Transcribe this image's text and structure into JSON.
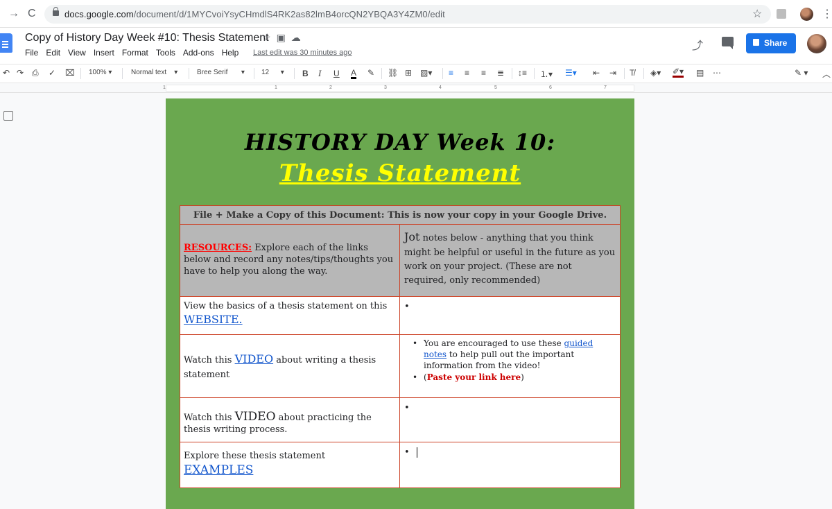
{
  "browser": {
    "url_main": "docs.google.com",
    "url_rest": "/document/d/1MYCvoiYsyCHmdlS4RK2as82lmB4orcQN2YBQA3Y4ZM0/edit"
  },
  "docs": {
    "title": "Copy of History Day Week #10: Thesis Statement",
    "menu": [
      "File",
      "Edit",
      "View",
      "Insert",
      "Format",
      "Tools",
      "Add-ons",
      "Help"
    ],
    "last_edit": "Last edit was 30 minutes ago",
    "share_label": "Share"
  },
  "toolbar": {
    "zoom": "100%",
    "style": "Normal text",
    "font": "Bree Serif",
    "size": "12",
    "bold": "B",
    "italic": "I",
    "underline": "U",
    "textcolor": "A"
  },
  "ruler": {
    "numbers": [
      "1",
      "1",
      "2",
      "3",
      "4",
      "5",
      "6",
      "7"
    ]
  },
  "document": {
    "heading1": "HISTORY DAY Week 10:",
    "heading2": "Thesis Statement",
    "table": {
      "header": "File + Make a Copy of this Document: This is now your copy in your Google Drive.",
      "resources_label": "RESOURCES:",
      "resources_text": " Explore each of the links below and record any notes/tips/thoughts you have to help you along the way.",
      "jot_big": "Jot",
      "jot_text": " notes below - anything that you think might be helpful or useful in the future as you work on your project. (These are not required, only recommended)",
      "row1_text": "View the basics of a thesis statement on this ",
      "row1_link": "WEBSITE.",
      "row2_pre": "Watch this ",
      "row2_link": "VIDEO",
      "row2_post": " about writing a thesis statement",
      "row2_note_pre": "You are encouraged to use these ",
      "row2_note_link": "guided notes",
      "row2_note_post": " to help pull out the important information from the video!",
      "row2_note2_open": "(",
      "row2_note2_red": "Paste your link here",
      "row2_note2_close": ")",
      "row3_pre": "Watch this ",
      "row3_link": "VIDEO",
      "row3_post": " about practicing the thesis writing process.",
      "row4_text": "Explore these thesis statement ",
      "row4_link": "EXAMPLES",
      "bullet": "•"
    }
  }
}
